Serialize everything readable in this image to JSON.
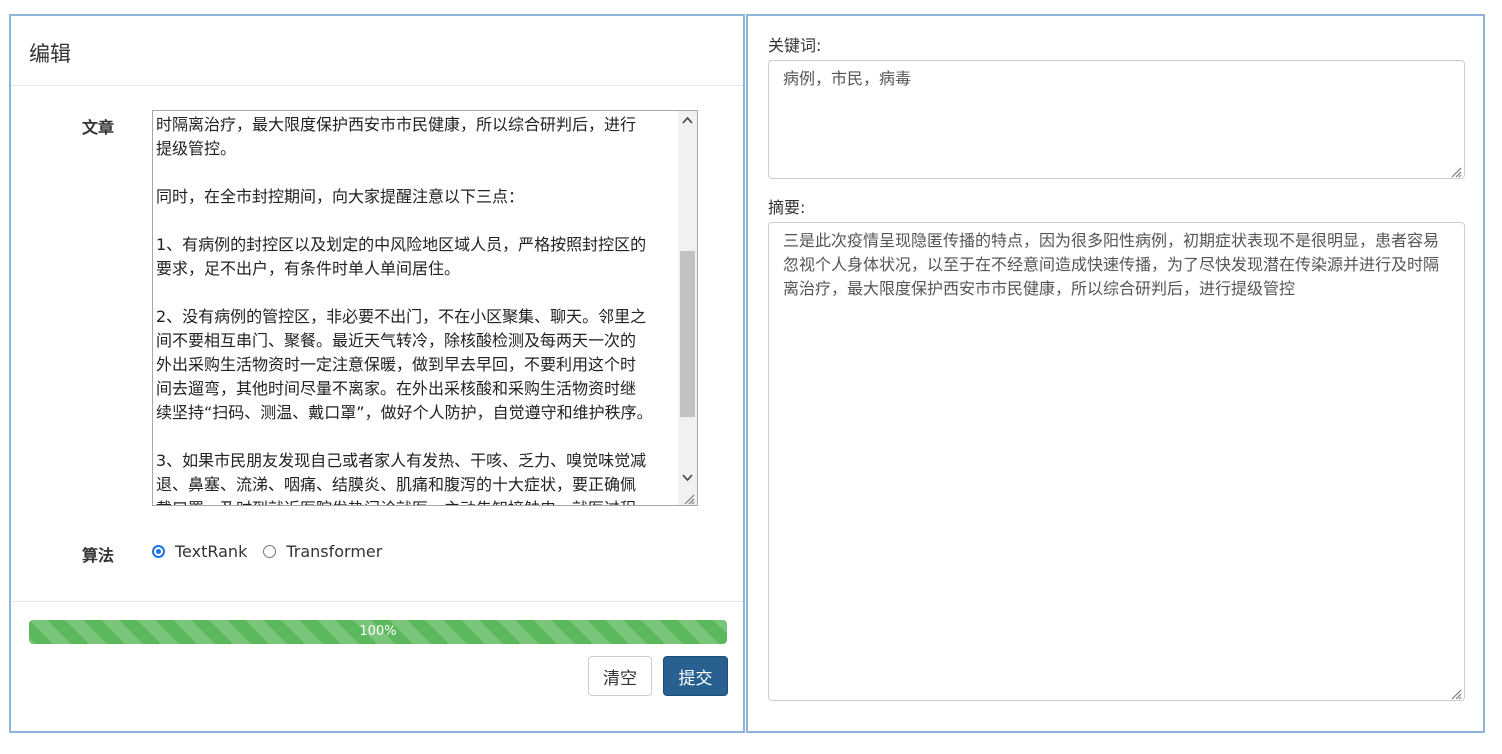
{
  "editor": {
    "title": "编辑",
    "article_label": "文章",
    "article_text": "时隔离治疗，最大限度保护西安市市民健康，所以综合研判后，进行\n提级管控。\n\n同时，在全市封控期间，向大家提醒注意以下三点：\n\n1、有病例的封控区以及划定的中风险地区域人员，严格按照封控区的\n要求，足不出户，有条件时单人单间居住。\n\n2、没有病例的管控区，非必要不出门，不在小区聚集、聊天。邻里之\n间不要相互串门、聚餐。最近天气转冷，除核酸检测及每两天一次的\n外出采购生活物资时一定注意保暖，做到早去早回，不要利用这个时\n间去遛弯，其他时间尽量不离家。在外出采核酸和采购生活物资时继\n续坚持“扫码、测温、戴口罩”，做好个人防护，自觉遵守和维护秩序。\n\n3、如果市民朋友发现自己或者家人有发热、干咳、乏力、嗅觉味觉减\n退、鼻塞、流涕、咽痛、结膜炎、肌痛和腹泻的十大症状，要正确佩\n戴口罩，及时到就近医院发热门诊就医，主动告知接触史，就医过程",
    "article_scroll_fraction": 0.35,
    "algorithm_label": "算法",
    "algorithms": [
      {
        "label": "TextRank",
        "selected": true
      },
      {
        "label": "Transformer",
        "selected": false
      }
    ],
    "progress": {
      "value": 1.0,
      "label": "100%"
    },
    "clear_button": "清空",
    "submit_button": "提交"
  },
  "result": {
    "keywords_label": "关键词:",
    "keywords_value": "病例，市民，病毒",
    "summary_label": "摘要:",
    "summary_value": "三是此次疫情呈现隐匿传播的特点，因为很多阳性病例，初期症状表现不是很明显，患者容易忽视个人身体状况，以至于在不经意间造成快速传播，为了尽快发现潜在传染源并进行及时隔离治疗，最大限度保护西安市市民健康，所以综合研判后，进行提级管控"
  },
  "colors": {
    "panel_border": "#8fb4d9",
    "progress": "#5cb85c",
    "submit": "#286090",
    "radio_checked": "#1a73e8"
  }
}
